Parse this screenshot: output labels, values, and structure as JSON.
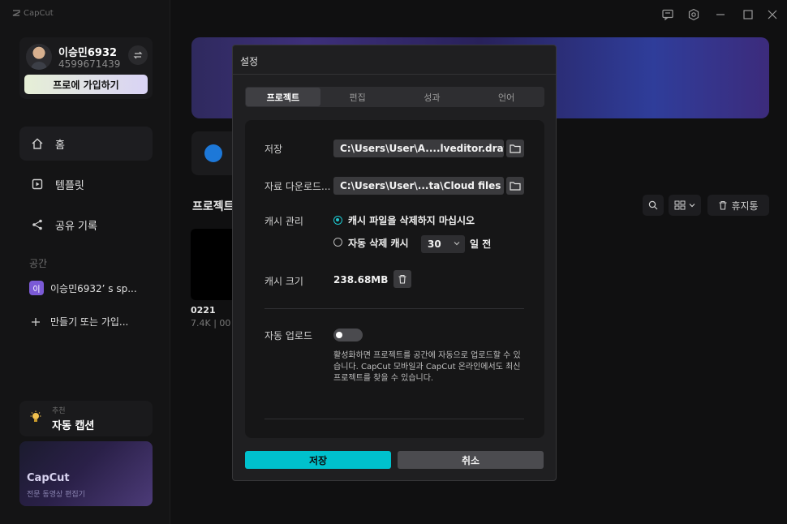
{
  "app": {
    "logo_text": "CapCut"
  },
  "sidebar": {
    "profile": {
      "name": "이승민6932",
      "id": "4599671439",
      "pro_button": "프로에 가입하기"
    },
    "nav": [
      {
        "label": "홈",
        "icon": "home-icon"
      },
      {
        "label": "템플릿",
        "icon": "template-icon"
      },
      {
        "label": "공유 기록",
        "icon": "share-icon"
      }
    ],
    "space_section": "공간",
    "space_item": {
      "badge": "이",
      "label": "이승민6932’ s sp..."
    },
    "create_item": "만들기 또는 가입...",
    "recommend_label": "추천",
    "auto_caption": "자동 캡션",
    "promo": {
      "title": "CapCut",
      "subtitle": "전문 동영상 편집기"
    }
  },
  "main": {
    "projects_label": "프로젝트",
    "project": {
      "title": "0221",
      "meta": "7.4K | 00"
    },
    "trash_label": "휴지통"
  },
  "modal": {
    "title": "설정",
    "tabs": [
      "프로젝트",
      "편집",
      "성과",
      "언어"
    ],
    "active_tab": 0,
    "save_path_label": "저장",
    "save_path_value": "C:\\Users\\User\\A....lveditor.draft",
    "download_label": "자료 다운로드...",
    "download_value": "C:\\Users\\User\\...ta\\Cloud files",
    "cache_manage_label": "캐시 관리",
    "cache_option_keep": "캐시 파일을 삭제하지 마십시오",
    "cache_option_auto": "자동 삭제 캐시",
    "cache_days": "30",
    "cache_days_suffix": "일 전",
    "cache_size_label": "캐시 크기",
    "cache_size_value": "238.68MB",
    "auto_upload_label": "자동 업로드",
    "auto_upload_enabled": false,
    "auto_upload_desc": "활성화하면 프로젝트를 공간에 자동으로 업로드할 수 있습니다. CapCut 모바일과 CapCut 온라인에서도 최신 프로젝트를 찾을 수 있습니다.",
    "save_button": "저장",
    "cancel_button": "취소"
  },
  "colors": {
    "accent": "#00c1cd",
    "modal_bg": "#1f1f21"
  }
}
